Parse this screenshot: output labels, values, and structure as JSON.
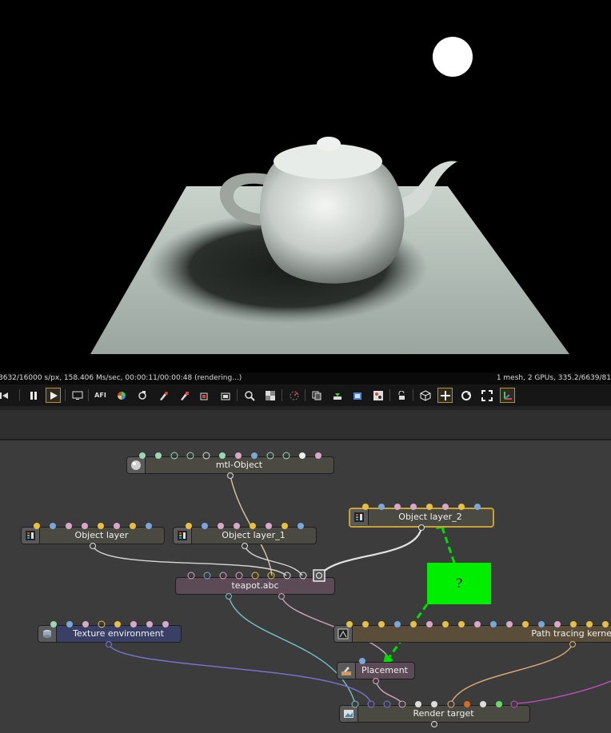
{
  "status": {
    "left": "3632/16000 s/px, 158.406 Ms/sec, 00:00:11/00:00:48 (rendering...)",
    "right": "1 mesh, 2 GPUs, 335.2/6639/81"
  },
  "toolbar": {
    "buttons": [
      "skip-back-icon",
      "pause-icon",
      "play-icon",
      "monitor-icon",
      "afi-icon",
      "color-wheel-icon",
      "refresh-icon",
      "pick-material-icon",
      "pick-object-icon",
      "pick-focus-icon",
      "pick-camera-icon",
      "zoom-icon",
      "checker-icon",
      "spinner-icon",
      "copy-icon",
      "import-icon",
      "export-icon",
      "gallery-icon",
      "lock-icon",
      "cube-icon",
      "move-icon",
      "orbit-icon",
      "fullscreen-icon",
      "axes-icon"
    ],
    "afi_label": "AFI"
  },
  "graph": {
    "nodes": {
      "mtl_object": "mtl-Object",
      "object_layer": "Object layer",
      "object_layer_1": "Object layer_1",
      "object_layer_2": "Object layer_2",
      "teapot": "teapot.abc",
      "texture_environment": "Texture environment",
      "path_tracing": "Path tracing kernel",
      "placement": "Placement",
      "render_target": "Render target"
    },
    "callout_text": "?",
    "colors": {
      "node_default": "#4a4a42",
      "node_geometry": "#5c4a56",
      "node_environment": "#3a3f66",
      "node_kernel": "#5a4e3a",
      "selection": "#c8a233",
      "callout": "#00ee00"
    }
  }
}
